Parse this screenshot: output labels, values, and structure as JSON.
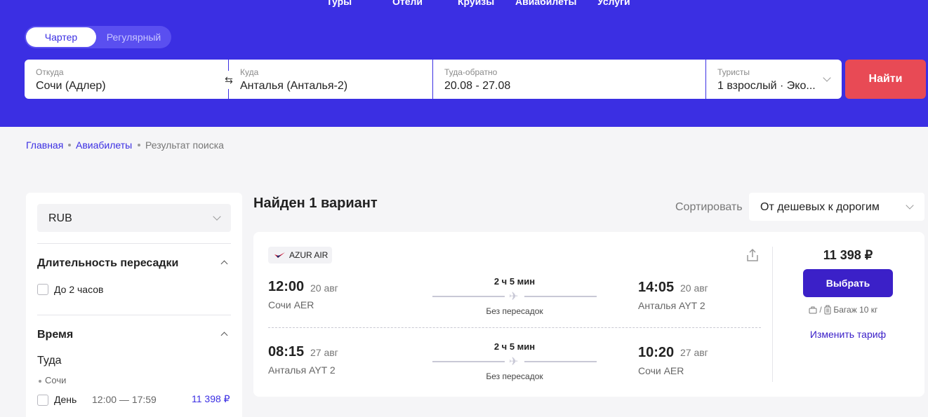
{
  "top_nav": [
    "Туры",
    "Отели",
    "Круизы",
    "Авиабилеты",
    "Услуги"
  ],
  "flight_type": {
    "active": "Чартер",
    "inactive": "Регулярный"
  },
  "search": {
    "from": {
      "label": "Откуда",
      "value": "Сочи (Адлер)"
    },
    "to": {
      "label": "Куда",
      "value": "Анталья (Анталья-2)"
    },
    "dates": {
      "label": "Туда-обратно",
      "value": "20.08 - 27.08"
    },
    "tourists": {
      "label": "Туристы",
      "value": "1 взрослый · Эко..."
    },
    "swap_icon": "swap-arrows-icon",
    "find_label": "Найти"
  },
  "breadcrumb": {
    "home": "Главная",
    "flights": "Авиабилеты",
    "current": "Результат поиска"
  },
  "filters": {
    "currency": "RUB",
    "transfer_title": "Длительность пересадки",
    "transfer_option": "До 2 часов",
    "time_title": "Время",
    "direction": "Туда",
    "city": "Сочи",
    "day_label": "День",
    "day_range": "12:00 — 17:59",
    "day_price": "11 398 ₽"
  },
  "results": {
    "found": "Найден 1 вариант",
    "sort_label": "Сортировать",
    "sort_value": "От дешевых к дорогим"
  },
  "offer": {
    "airline": "AZUR AIR",
    "outbound": {
      "dep_time": "12:00",
      "dep_date": "20 авг",
      "dep_city": "Сочи AER",
      "duration": "2 ч 5 мин",
      "stops": "Без пересадок",
      "arr_time": "14:05",
      "arr_date": "20 авг",
      "arr_city": "Анталья AYT 2"
    },
    "inbound": {
      "dep_time": "08:15",
      "dep_date": "27 авг",
      "dep_city": "Анталья AYT 2",
      "duration": "2 ч 5 мин",
      "stops": "Без пересадок",
      "arr_time": "10:20",
      "arr_date": "27 авг",
      "arr_city": "Сочи AER"
    },
    "price": "11 398 ₽",
    "select_label": "Выбрать",
    "baggage": "Багаж 10 кг",
    "change_tariff": "Изменить тариф"
  },
  "colors": {
    "brand": "#3b2fe3",
    "find_button": "#e84a55",
    "select_button": "#3b20c8"
  }
}
